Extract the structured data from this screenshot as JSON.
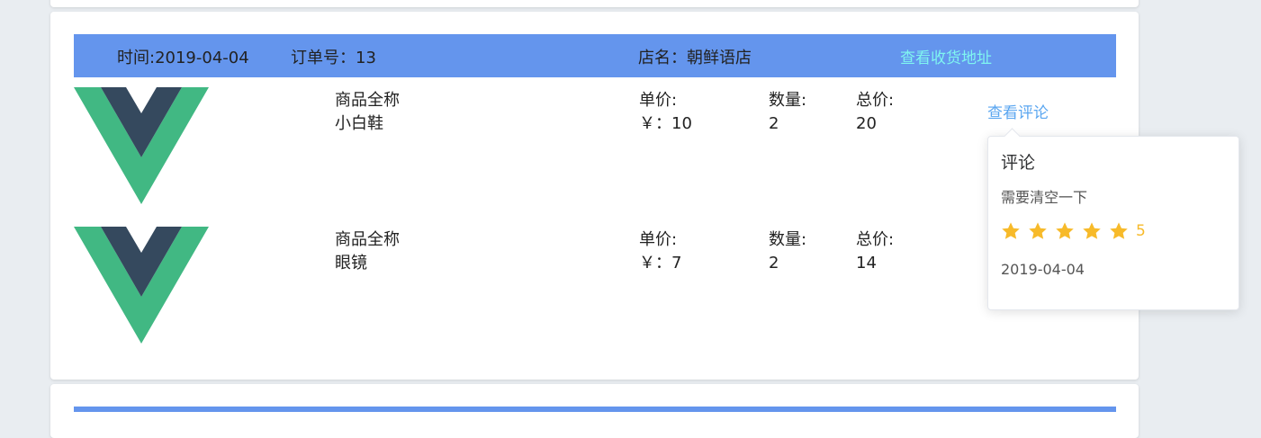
{
  "order": {
    "time": "时间:2019-04-04",
    "order_no": "订单号：13",
    "shop": "店名：朝鲜语店",
    "view_address": "查看收货地址"
  },
  "items": [
    {
      "name_label": "商品全称",
      "name": "小白鞋",
      "price_label": "单价:",
      "price": "￥：10",
      "qty_label": "数量:",
      "qty": "2",
      "total_label": "总价:",
      "total": "20",
      "review_link": "查看评论"
    },
    {
      "name_label": "商品全称",
      "name": "眼镜",
      "price_label": "单价:",
      "price": "￥：7",
      "qty_label": "数量:",
      "qty": "2",
      "total_label": "总价:",
      "total": "14"
    }
  ],
  "review": {
    "title": "评论",
    "content": "需要清空一下",
    "rating": 5,
    "rating_text": "5",
    "date": "2019-04-04"
  },
  "colors": {
    "header_bg": "#6495ed",
    "address_link": "#7ff5f0",
    "review_link": "#5aa6f0",
    "star": "#f7ba2a",
    "vue_green": "#41b883",
    "vue_dark": "#35495e"
  },
  "icons": [
    "vue-logo-icon",
    "star-icon"
  ]
}
